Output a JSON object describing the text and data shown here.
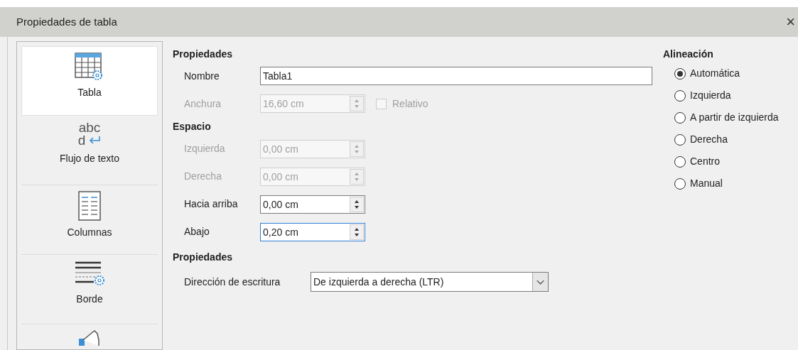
{
  "window": {
    "title": "Propiedades de tabla",
    "close": "×"
  },
  "tabs": [
    {
      "kind": "table",
      "label": "Tabla",
      "selected": true
    },
    {
      "kind": "textflow",
      "label": "Flujo de texto",
      "selected": false,
      "glyph_top": "abc",
      "glyph_bottom": "d"
    },
    {
      "kind": "columns",
      "label": "Columnas",
      "selected": false
    },
    {
      "kind": "border",
      "label": "Borde",
      "selected": false
    },
    {
      "kind": "hand",
      "selected": false
    }
  ],
  "properties": {
    "heading": "Propiedades",
    "name": {
      "label": "Nombre",
      "value": "Tabla1"
    },
    "width": {
      "label": "Anchura",
      "value": "16,60 cm",
      "disabled": true,
      "relative": {
        "label": "Relativo",
        "checked": false,
        "disabled": true
      }
    }
  },
  "spacing": {
    "heading": "Espacio",
    "fields": [
      {
        "label": "Izquierda",
        "value": "0,00 cm",
        "disabled": true,
        "focused": false
      },
      {
        "label": "Derecha",
        "value": "0,00 cm",
        "disabled": true,
        "focused": false
      },
      {
        "label": "Hacia arriba",
        "value": "0,00 cm",
        "disabled": false,
        "focused": false
      },
      {
        "label": "Abajo",
        "value": "0,20 cm",
        "disabled": false,
        "focused": true
      }
    ]
  },
  "properties_2": {
    "heading": "Propiedades",
    "direction": {
      "label": "Dirección de escritura",
      "value": "De izquierda a derecha (LTR)"
    }
  },
  "alignment": {
    "heading": "Alineación",
    "options": [
      {
        "label": "Automática",
        "selected": true
      },
      {
        "label": "Izquierda",
        "selected": false
      },
      {
        "label": "A partir de izquierda",
        "selected": false
      },
      {
        "label": "Derecha",
        "selected": false
      },
      {
        "label": "Centro",
        "selected": false
      },
      {
        "label": "Manual",
        "selected": false
      }
    ]
  }
}
